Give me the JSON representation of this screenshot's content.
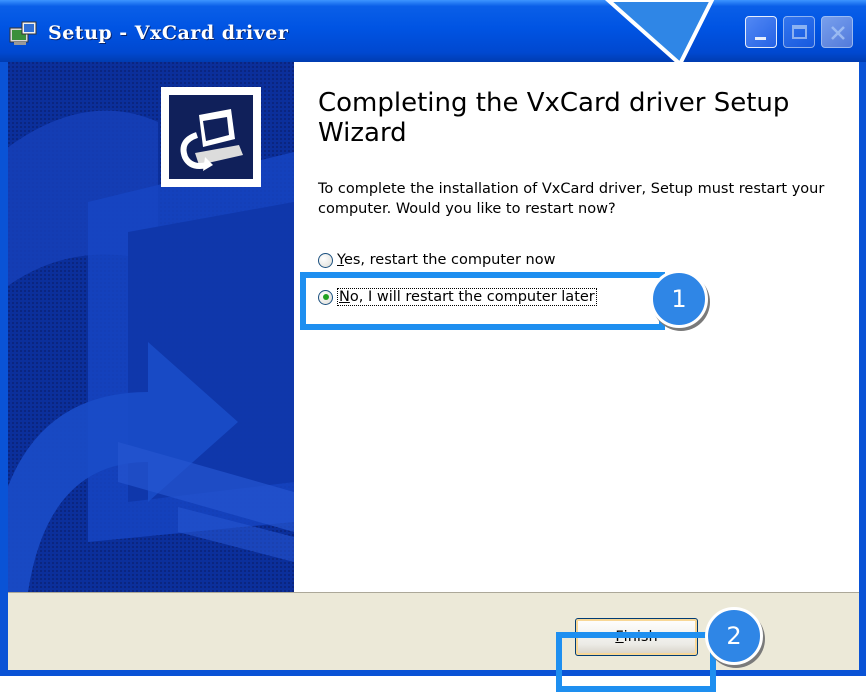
{
  "window": {
    "title": "Setup - VxCard driver"
  },
  "title_buttons": {
    "minimize": "minimize-icon",
    "maximize": "maximize-icon",
    "close": "close-icon"
  },
  "content": {
    "heading": "Completing the VxCard driver Setup Wizard",
    "description": "To complete the installation of VxCard driver, Setup must restart your computer. Would you like to restart now?",
    "options": [
      {
        "mnemonic": "Y",
        "rest": "es, restart the computer now",
        "checked": false
      },
      {
        "mnemonic": "N",
        "rest": "o, I will restart the computer later",
        "checked": true
      }
    ]
  },
  "buttons": {
    "finish_mnemonic": "F",
    "finish_rest": "inish"
  },
  "annotations": {
    "badge1": "1",
    "badge2": "2"
  },
  "colors": {
    "titlebar": "#0054e3",
    "highlight": "#1e8ff0",
    "badge": "#2f86e6",
    "panel": "#0b2f9b",
    "bottom_bar": "#ece9d8"
  }
}
